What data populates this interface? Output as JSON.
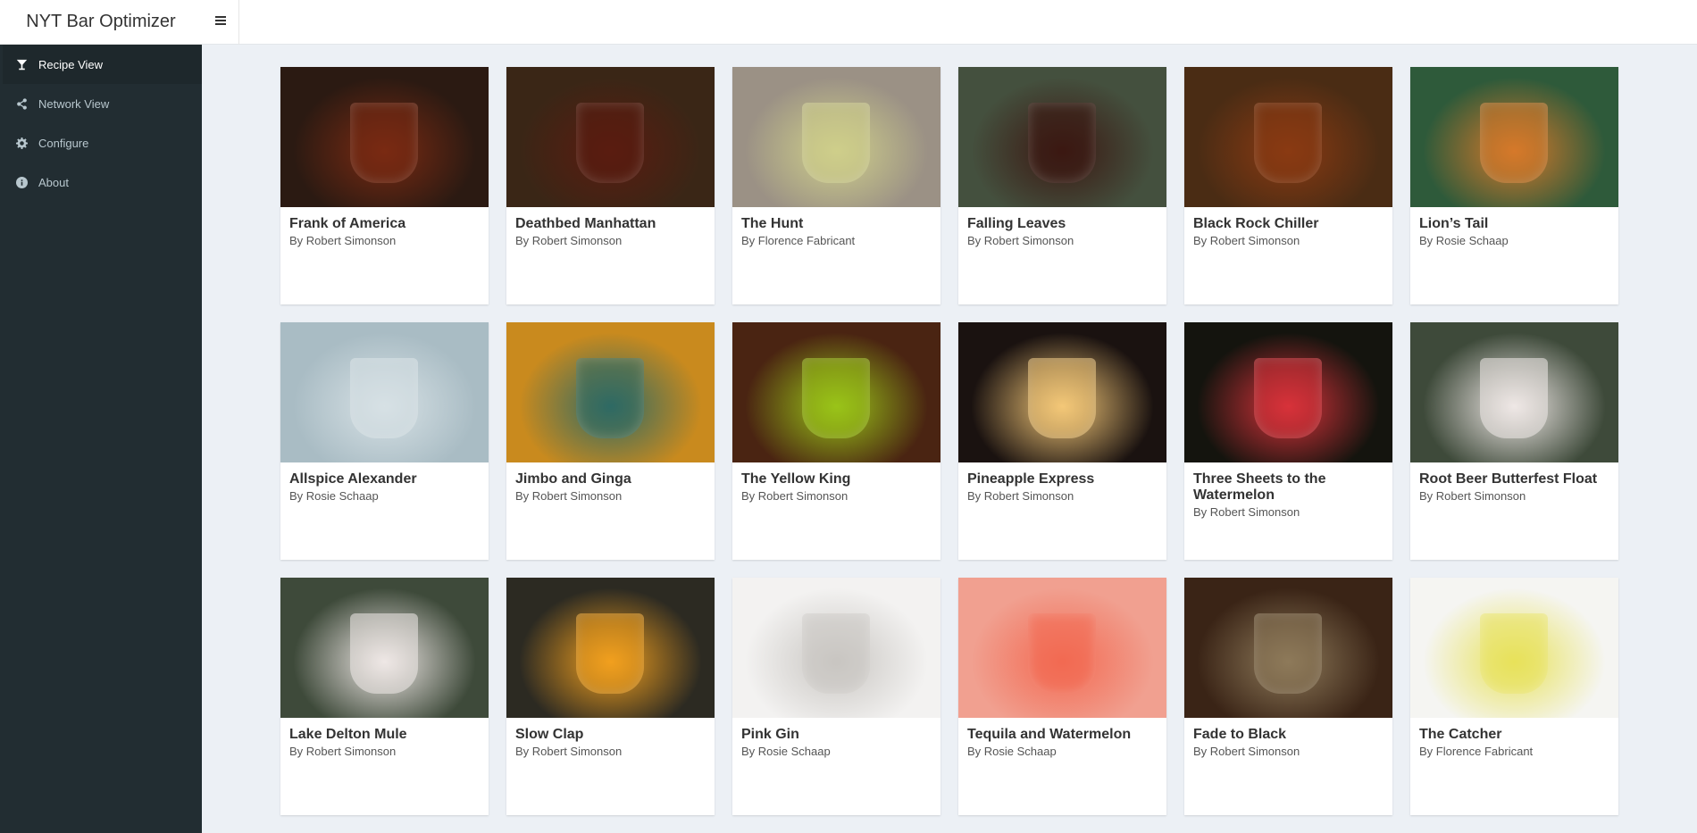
{
  "app": {
    "title": "NYT Bar Optimizer"
  },
  "sidebar": {
    "items": [
      {
        "label": "Recipe View",
        "icon": "cocktail-glass-icon",
        "active": true
      },
      {
        "label": "Network View",
        "icon": "share-network-icon",
        "active": false
      },
      {
        "label": "Configure",
        "icon": "gear-icon",
        "active": false
      },
      {
        "label": "About",
        "icon": "info-circle-icon",
        "active": false
      }
    ]
  },
  "header": {
    "toggle_icon": "hamburger-menu-icon"
  },
  "recipes": [
    {
      "title": "Frank of America",
      "author": "By Robert Simonson",
      "bg": "#2b1a12",
      "accent": "#7a2a12"
    },
    {
      "title": "Deathbed Manhattan",
      "author": "By Robert Simonson",
      "bg": "#3a2616",
      "accent": "#5a1c10"
    },
    {
      "title": "The Hunt",
      "author": "By Florence Fabricant",
      "bg": "#9b9185",
      "accent": "#cfcf8a"
    },
    {
      "title": "Falling Leaves",
      "author": "By Robert Simonson",
      "bg": "#44503e",
      "accent": "#3b1812"
    },
    {
      "title": "Black Rock Chiller",
      "author": "By Robert Simonson",
      "bg": "#4a2c14",
      "accent": "#8a3a12"
    },
    {
      "title": "Lion’s Tail",
      "author": "By Rosie Schaap",
      "bg": "#2e5a3a",
      "accent": "#d6792a"
    },
    {
      "title": "Allspice Alexander",
      "author": "By Rosie Schaap",
      "bg": "#a9bcc4",
      "accent": "#d7e1e5"
    },
    {
      "title": "Jimbo and Ginga",
      "author": "By Robert Simonson",
      "bg": "#c98a1e",
      "accent": "#2e6a64"
    },
    {
      "title": "The Yellow King",
      "author": "By Robert Simonson",
      "bg": "#4a2412",
      "accent": "#9ac418"
    },
    {
      "title": "Pineapple Express",
      "author": "By Robert Simonson",
      "bg": "#1a1210",
      "accent": "#f4c878"
    },
    {
      "title": "Three Sheets to the Watermelon",
      "author": "By Robert Simonson",
      "bg": "#14140e",
      "accent": "#d8323a"
    },
    {
      "title": "Root Beer Butterfest Float",
      "author": "By Robert Simonson",
      "bg": "#3e4a3a",
      "accent": "#efe8e6"
    },
    {
      "title": "Lake Delton Mule",
      "author": "By Robert Simonson",
      "bg": "#3e4a3a",
      "accent": "#efe8e6"
    },
    {
      "title": "Slow Clap",
      "author": "By Robert Simonson",
      "bg": "#2c2a22",
      "accent": "#f2a01e"
    },
    {
      "title": "Pink Gin",
      "author": "By Rosie Schaap",
      "bg": "#f3f2f1",
      "accent": "#c9c6c2"
    },
    {
      "title": "Tequila and Watermelon",
      "author": "By Rosie Schaap",
      "bg": "#f1a090",
      "accent": "#f26a52"
    },
    {
      "title": "Fade to Black",
      "author": "By Robert Simonson",
      "bg": "#3a2416",
      "accent": "#8e7a5a"
    },
    {
      "title": "The Catcher",
      "author": "By Florence Fabricant",
      "bg": "#f5f5f2",
      "accent": "#e8e25a"
    }
  ]
}
